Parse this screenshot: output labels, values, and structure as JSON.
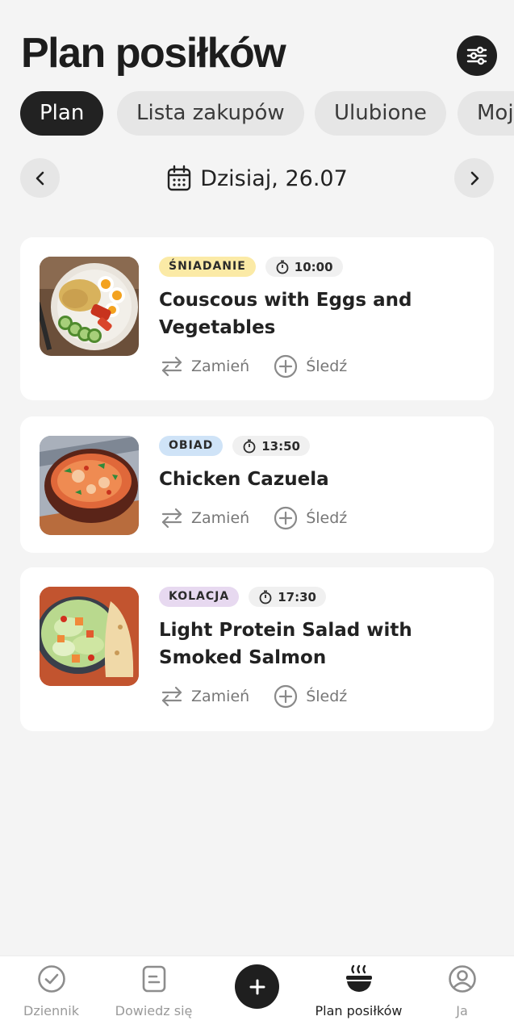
{
  "header": {
    "title": "Plan posiłków",
    "filter_icon": "sliders-icon"
  },
  "tabs": [
    {
      "label": "Plan",
      "active": true
    },
    {
      "label": "Lista zakupów",
      "active": false
    },
    {
      "label": "Ulubione",
      "active": false
    },
    {
      "label": "Moje",
      "active": false
    }
  ],
  "date_nav": {
    "label": "Dzisiaj, 26.07",
    "prev_icon": "chevron-left-icon",
    "next_icon": "chevron-right-icon",
    "calendar_icon": "calendar-icon"
  },
  "meals": [
    {
      "category": "ŚNIADANIE",
      "category_color": "#fbeaa6",
      "time": "10:00",
      "title": "Couscous with Eggs and Vegetables",
      "image": "couscous-eggs-photo",
      "swap_label": "Zamień",
      "track_label": "Śledź"
    },
    {
      "category": "OBIAD",
      "category_color": "#cfe3f7",
      "time": "13:50",
      "title": "Chicken Cazuela",
      "image": "chicken-cazuela-photo",
      "swap_label": "Zamień",
      "track_label": "Śledź"
    },
    {
      "category": "KOLACJA",
      "category_color": "#e7d9f0",
      "time": "17:30",
      "title": "Light Protein Salad with Smoked Salmon",
      "image": "salmon-salad-photo",
      "swap_label": "Zamień",
      "track_label": "Śledź"
    }
  ],
  "bottom_nav": [
    {
      "label": "Dziennik",
      "icon": "check-circle-icon",
      "active": false
    },
    {
      "label": "Dowiedz się",
      "icon": "document-icon",
      "active": false
    },
    {
      "label": "",
      "icon": "plus-icon",
      "active": false
    },
    {
      "label": "Plan posiłków",
      "icon": "bowl-icon",
      "active": true
    },
    {
      "label": "Ja",
      "icon": "user-circle-icon",
      "active": false
    }
  ]
}
